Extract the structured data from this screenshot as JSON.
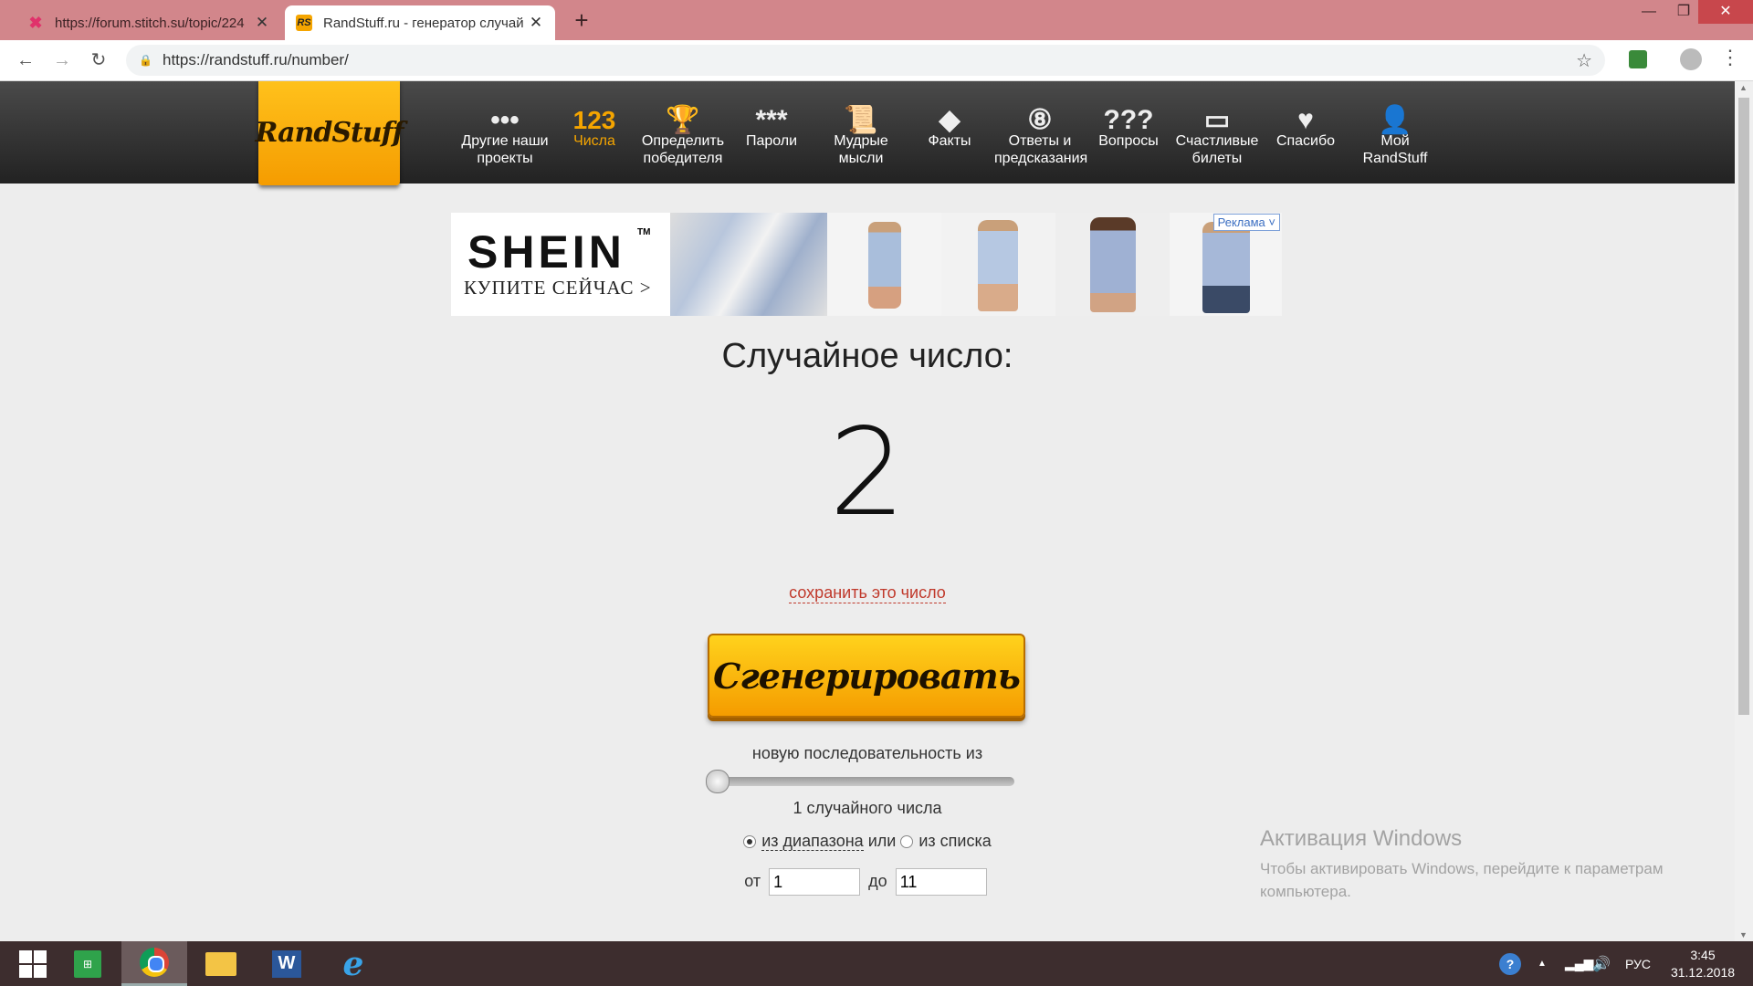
{
  "browser": {
    "tabs": [
      {
        "title": "https://forum.stitch.su/topic/224",
        "active": false
      },
      {
        "title": "RandStuff.ru - генератор случай",
        "active": true
      }
    ],
    "url": "https://randstuff.ru/number/"
  },
  "site": {
    "logo": "RandStuff",
    "nav": [
      {
        "icon": "•••",
        "label": "Другие наши проекты"
      },
      {
        "icon": "123",
        "label": "Числа"
      },
      {
        "icon": "🏆",
        "label": "Определить победителя"
      },
      {
        "icon": "***",
        "label": "Пароли"
      },
      {
        "icon": "📜",
        "label": "Мудрые мысли"
      },
      {
        "icon": "◆",
        "label": "Факты"
      },
      {
        "icon": "⑧",
        "label": "Ответы и предсказания"
      },
      {
        "icon": "???",
        "label": "Вопросы"
      },
      {
        "icon": "▭",
        "label": "Счастливые билеты"
      },
      {
        "icon": "♥",
        "label": "Спасибо"
      },
      {
        "icon": "👤",
        "label": "Мой RandStuff"
      }
    ]
  },
  "ad": {
    "brand": "SHEIN",
    "tm": "TM",
    "cta": "КУПИТЕ СЕЙЧАС >",
    "label": "Реклама ˅"
  },
  "main": {
    "heading": "Случайное число:",
    "number": "2",
    "save_link": "сохранить это число",
    "generate_button": "Сгенерировать",
    "sequence_text": "новую последовательность из",
    "slider_value": 1,
    "count_text": "1 случайного числа",
    "mode_range": "из диапазона",
    "mode_or": "или",
    "mode_list": "из списка",
    "from_label": "от",
    "from_value": "1",
    "to_label": "до",
    "to_value": "11"
  },
  "watermark": {
    "title": "Активация Windows",
    "text": "Чтобы активировать Windows, перейдите к параметрам компьютера."
  },
  "taskbar": {
    "lang": "РУС",
    "time": "3:45",
    "date": "31.12.2018"
  }
}
